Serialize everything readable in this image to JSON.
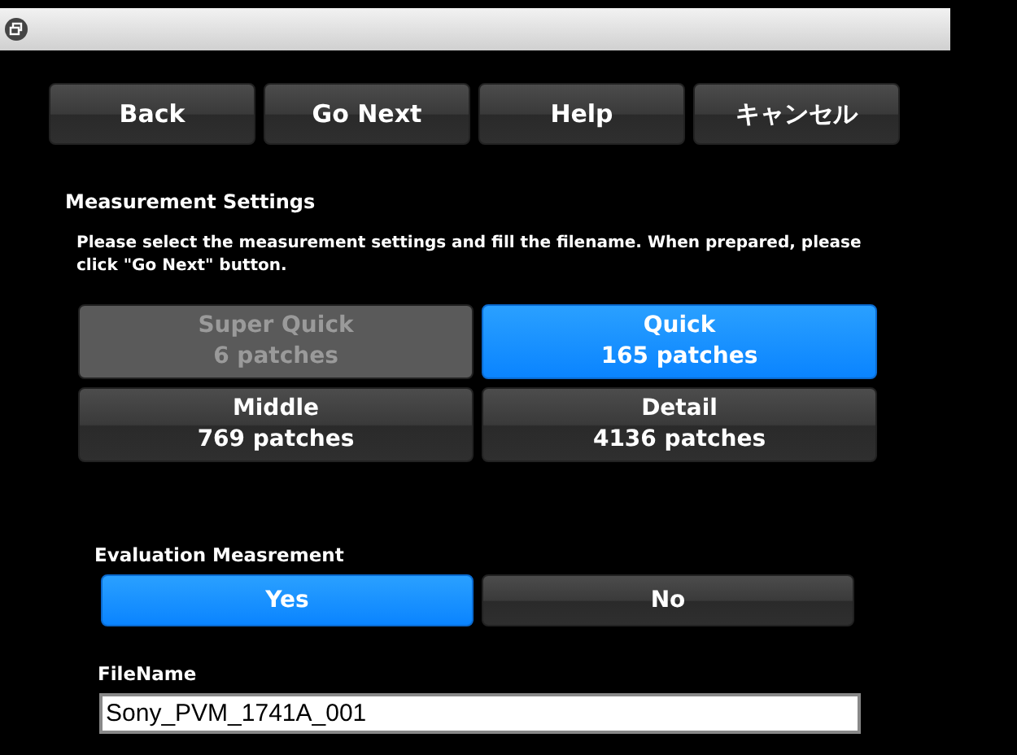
{
  "nav_buttons": [
    {
      "label": "Back"
    },
    {
      "label": "Go Next"
    },
    {
      "label": "Help"
    },
    {
      "label": "キャンセル"
    }
  ],
  "settings": {
    "heading": "Measurement Settings",
    "instructions": "Please select the measurement settings and fill the filename. When prepared, please click \"Go Next\" button.",
    "options": [
      {
        "name": "Super Quick",
        "patches": "6 patches",
        "selected": false,
        "disabled": true
      },
      {
        "name": "Quick",
        "patches": "165 patches",
        "selected": true,
        "disabled": false
      },
      {
        "name": "Middle",
        "patches": "769 patches",
        "selected": false,
        "disabled": false
      },
      {
        "name": "Detail",
        "patches": "4136 patches",
        "selected": false,
        "disabled": false
      }
    ]
  },
  "evaluation": {
    "label": "Evaluation Measrement",
    "choices": [
      {
        "label": "Yes",
        "selected": true
      },
      {
        "label": "No",
        "selected": false
      }
    ]
  },
  "filename": {
    "label": "FileName",
    "value": "Sony_PVM_1741A_001"
  }
}
